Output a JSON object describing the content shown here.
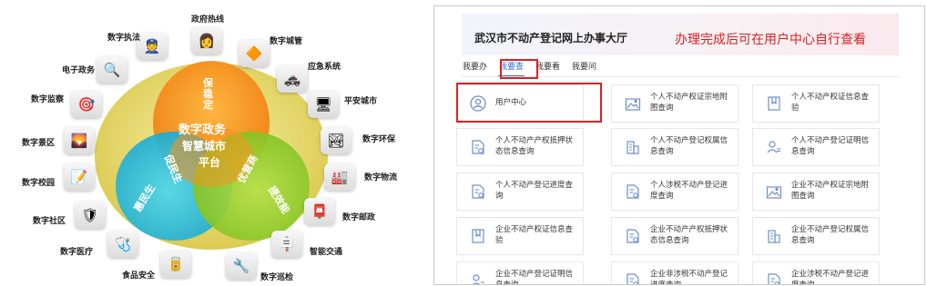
{
  "diagram": {
    "center_lines": [
      "数字政务",
      "智慧城市",
      "平台"
    ],
    "top_segment": "保稳定",
    "left_segment": "促民生",
    "right_segment": "优营商",
    "bottom_left_curve": "惠民生",
    "bottom_right_curve": "提效能",
    "nodes": [
      {
        "label": "政府热线",
        "icon": "phone-operator-icon"
      },
      {
        "label": "数字城管",
        "icon": "traffic-cone-icon"
      },
      {
        "label": "应急系统",
        "icon": "police-car-icon"
      },
      {
        "label": "平安城市",
        "icon": "monitor-icon"
      },
      {
        "label": "数字环保",
        "icon": "eco-icon"
      },
      {
        "label": "数字物流",
        "icon": "warehouse-icon"
      },
      {
        "label": "数字邮政",
        "icon": "mailbox-icon"
      },
      {
        "label": "智能交通",
        "icon": "signpost-icon"
      },
      {
        "label": "数字巡检",
        "icon": "inspection-icon"
      },
      {
        "label": "食品安全",
        "icon": "food-icon"
      },
      {
        "label": "数字医疗",
        "icon": "first-aid-icon"
      },
      {
        "label": "数字社区",
        "icon": "community-shield-icon"
      },
      {
        "label": "数字校园",
        "icon": "campus-icon"
      },
      {
        "label": "数字景区",
        "icon": "scenic-icon"
      },
      {
        "label": "数字监察",
        "icon": "target-icon"
      },
      {
        "label": "电子政务",
        "icon": "magnifier-icon"
      },
      {
        "label": "数字执法",
        "icon": "law-enforcement-icon"
      }
    ]
  },
  "portal": {
    "title": "武汉市不动产登记网上办事大厅",
    "notice": "办理完成后可在用户中心自行查看",
    "tabs": [
      {
        "label": "我要办"
      },
      {
        "label": "我要查"
      },
      {
        "label": "我要看"
      },
      {
        "label": "我要问"
      }
    ],
    "cards": [
      {
        "label": "用户中心",
        "icon": "user-circle-icon"
      },
      {
        "label": "个人不动产权证宗地附图查询",
        "icon": "map-pin-icon"
      },
      {
        "label": "个人不动产权证信息查验",
        "icon": "bookmark-icon"
      },
      {
        "label": "个人不动产产权抵押状态信息查询",
        "icon": "document-check-icon"
      },
      {
        "label": "个人不动产登记权属信息查询",
        "icon": "building-icon"
      },
      {
        "label": "个人不动产登记证明信息查询",
        "icon": "user-list-icon"
      },
      {
        "label": "个人不动产登记进度查询",
        "icon": "document-check-icon"
      },
      {
        "label": "个人涉税不动产登记进度查询",
        "icon": "document-check-icon"
      },
      {
        "label": "企业不动产权证宗地附图查询",
        "icon": "map-pin-icon"
      },
      {
        "label": "企业不动产权证信息查验",
        "icon": "bookmark-icon"
      },
      {
        "label": "企业不动产产权抵押状态信息查询",
        "icon": "document-check-icon"
      },
      {
        "label": "企业不动产登记权属信息查询",
        "icon": "building-icon"
      },
      {
        "label": "企业不动产登记证明信息查询",
        "icon": "user-list-icon"
      },
      {
        "label": "企业非涉税不动产登记进度查询",
        "icon": "document-check-icon"
      },
      {
        "label": "企业涉税不动产登记进度查询",
        "icon": "document-check-icon"
      }
    ],
    "colors": {
      "accent": "#2f6fd6",
      "highlight": "#e02020",
      "icon": "#6d8fc9"
    }
  }
}
